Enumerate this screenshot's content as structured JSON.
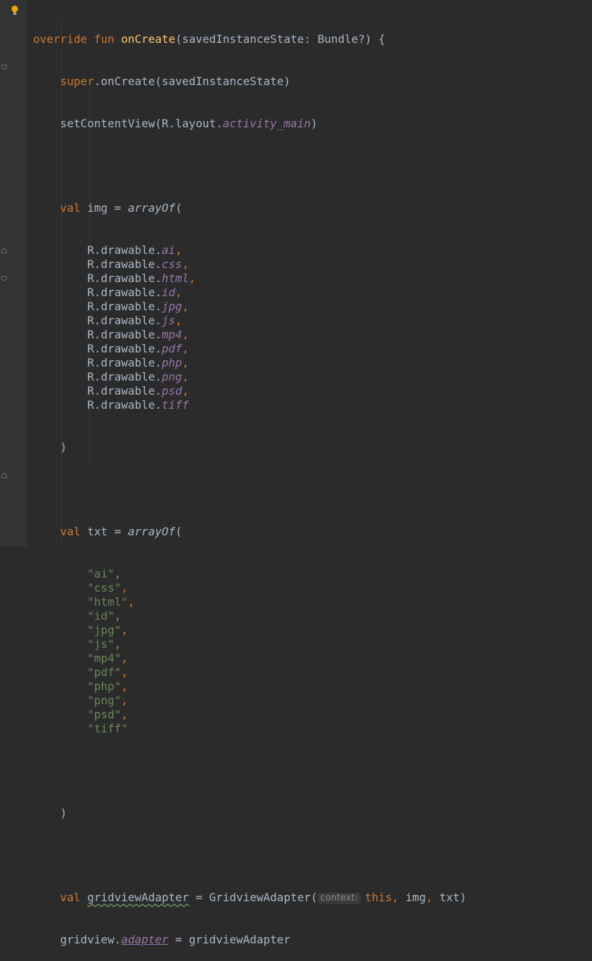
{
  "colors": {
    "background": "#2b2b2b",
    "gutter": "#313335",
    "default_text": "#a9b7c6",
    "keyword": "#cc7832",
    "function": "#ffc66d",
    "field": "#9876aa",
    "string": "#6a8759",
    "hint": "#8c8c8c"
  },
  "gutter": {
    "bulb_icon": "lightbulb-icon",
    "fold_icon": "fold-marker-icon"
  },
  "code": {
    "l1": {
      "override": "override",
      "fun": "fun",
      "name": "onCreate",
      "params": "(savedInstanceState: Bundle?) {"
    },
    "l2": {
      "super": "super",
      "call": ".onCreate(savedInstanceState)"
    },
    "l3": {
      "call": "setContentView(R.layout.",
      "field": "activity_main",
      "close": ")"
    },
    "l5": {
      "val": "val",
      "decl": " img = ",
      "fn": "arrayOf",
      "open": "("
    },
    "img_items": [
      {
        "prefix": "R.drawable.",
        "name": "ai",
        "sep": ","
      },
      {
        "prefix": "R.drawable.",
        "name": "css",
        "sep": ","
      },
      {
        "prefix": "R.drawable.",
        "name": "html",
        "sep": ","
      },
      {
        "prefix": "R.drawable.",
        "name": "id",
        "sep": ","
      },
      {
        "prefix": "R.drawable.",
        "name": "jpg",
        "sep": ","
      },
      {
        "prefix": "R.drawable.",
        "name": "js",
        "sep": ","
      },
      {
        "prefix": "R.drawable.",
        "name": "mp4",
        "sep": ","
      },
      {
        "prefix": "R.drawable.",
        "name": "pdf",
        "sep": ","
      },
      {
        "prefix": "R.drawable.",
        "name": "php",
        "sep": ","
      },
      {
        "prefix": "R.drawable.",
        "name": "png",
        "sep": ","
      },
      {
        "prefix": "R.drawable.",
        "name": "psd",
        "sep": ","
      },
      {
        "prefix": "R.drawable.",
        "name": "tiff",
        "sep": ""
      }
    ],
    "close_paren": ")",
    "l20": {
      "val": "val",
      "decl": " txt = ",
      "fn": "arrayOf",
      "open": "("
    },
    "txt_items": [
      {
        "str": "\"ai\"",
        "sep": ","
      },
      {
        "str": "\"css\"",
        "sep": ","
      },
      {
        "str": "\"html\"",
        "sep": ","
      },
      {
        "str": "\"id\"",
        "sep": ","
      },
      {
        "str": "\"jpg\"",
        "sep": ","
      },
      {
        "str": "\"js\"",
        "sep": ","
      },
      {
        "str": "\"mp4\"",
        "sep": ","
      },
      {
        "str": "\"pdf\"",
        "sep": ","
      },
      {
        "str": "\"php\"",
        "sep": ","
      },
      {
        "str": "\"png\"",
        "sep": ","
      },
      {
        "str": "\"psd\"",
        "sep": ","
      },
      {
        "str": "\"tiff\"",
        "sep": ""
      }
    ],
    "l36": {
      "val": "val",
      "space": " ",
      "var": "gridviewAdapter",
      "assign": " = GridviewAdapter(",
      "hint": "context:",
      "this": "this",
      "sep1": ", ",
      "arg2": "img",
      "sep2": ", ",
      "arg3": "txt",
      "close": ")"
    },
    "l37": {
      "obj": "gridview.",
      "prop": "adapter",
      "assign": " = gridviewAdapter"
    }
  }
}
